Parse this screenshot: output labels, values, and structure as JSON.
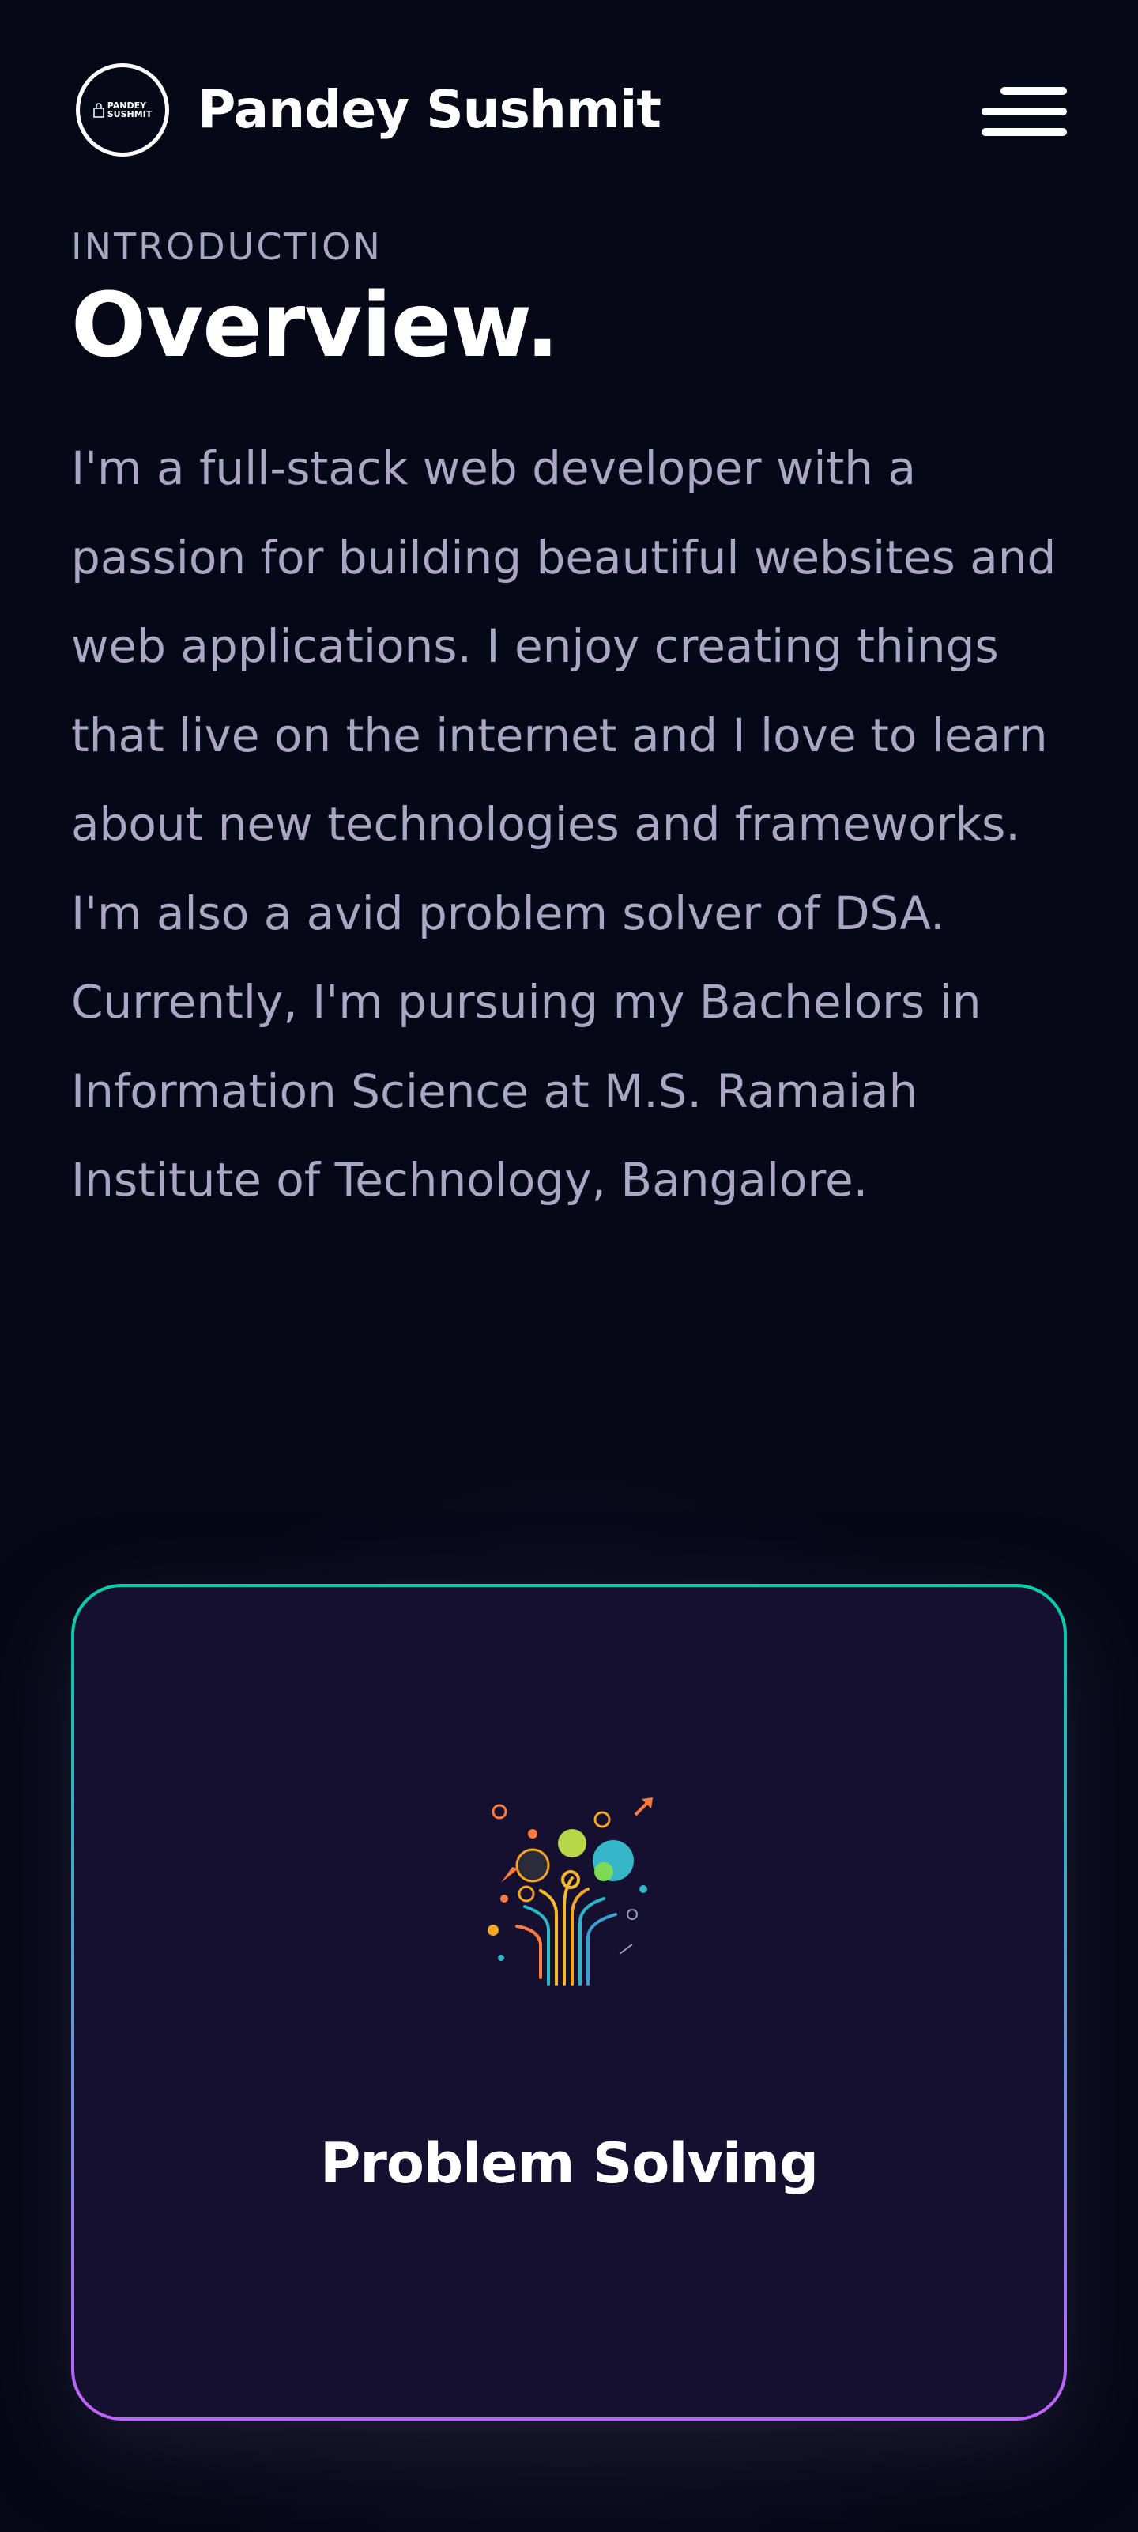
{
  "navbar": {
    "logo_text_line1": "PANDEY",
    "logo_text_line2": "SUSHMIT",
    "brand_name": "Pandey Sushmit",
    "menu_icon": "hamburger-menu-icon"
  },
  "about": {
    "subtitle": "INTRODUCTION",
    "heading": "Overview.",
    "paragraph": "I'm a full-stack web developer with a passion for building beautiful websites and web applications. I enjoy creating things that live on the internet and I love to learn about new technologies and frameworks. I'm also a avid problem solver of DSA. Currently, I'm pursuing my Bachelors in Information Science at M.S. Ramaiah Institute of Technology, Bangalore."
  },
  "services": [
    {
      "title": "Problem Solving",
      "icon": "problem-solving-tree-icon"
    }
  ],
  "colors": {
    "background": "#050816",
    "secondary_text": "#aaa6c3",
    "card_bg": "#151030",
    "gradient_start": "#00cea8",
    "gradient_end": "#bf61ff",
    "white": "#ffffff"
  }
}
